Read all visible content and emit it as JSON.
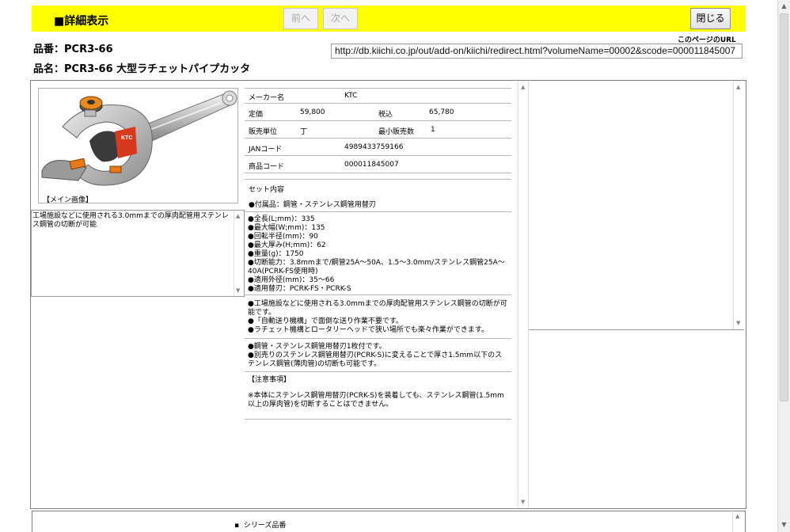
{
  "header": {
    "title": "■詳細表示",
    "prev_label": "前へ",
    "next_label": "次へ",
    "close_label": "閉じる"
  },
  "product": {
    "number_line": "品番：PCR3-66",
    "name_line": "品名：PCR3-66 大型ラチェットパイプカッタ"
  },
  "url": {
    "label": "このページのURL",
    "value": "http://db.kiichi.co.jp/out/add-on/kiichi/redirect.html?volumeName=00002&scode=000011845007"
  },
  "image": {
    "caption": "【メイン画像】",
    "brand": "KTC"
  },
  "description": "工場施設などに使用される3.0mmまでの厚肉配管用ステンレス鋼管の切断が可能",
  "specs": {
    "maker_label": "メーカー名",
    "maker_value": "KTC",
    "price_label": "定価",
    "price_value": "59,800",
    "tax_label": "税込",
    "tax_value": "65,780",
    "unit_label": "販売単位",
    "unit_value": "丁",
    "min_label": "最小販売数",
    "min_value": "1",
    "jan_label": "JANコード",
    "jan_value": "4989433759166",
    "code_label": "商品コード",
    "code_value": "000011845007"
  },
  "set_content": {
    "label": "セット内容",
    "value": "●付属品：鋼管・ステンレス鋼管用替刃"
  },
  "dimensions": [
    "●全長(L;mm)：335",
    "●最大幅(W;mm)：135",
    "●回転半径(mm)：90",
    "●最大厚み(H;mm)：62",
    "●重量(g)：1750",
    "●切断能力：3.8mmまで/鋼管25A～50A、1.5～3.0mm/ステンレス鋼管25A～40A(PCRK-FS使用時)",
    "●適用外径(mm)：35～66",
    "●適用替刃：PCRK-FS・PCRK-S"
  ],
  "features": [
    "●工場施設などに使用される3.0mmまでの厚肉配管用ステンレス鋼管の切断が可能です。",
    "●「自動送り機構」で面倒な送り作業不要です。",
    "●ラチェット機構とロータリーヘッドで狭い場所でも楽々作業ができます。"
  ],
  "notes": [
    "●鋼管・ステンレス鋼管用替刃1枚付です。",
    "●別売りのステンレス鋼管用替刃(PCRK-S)に変えることで厚さ1.5mm以下のステンレス鋼管(薄肉管)の切断も可能です。"
  ],
  "caution": {
    "label": "【注意事項】",
    "text": "※本体にステンレス鋼管用替刃(PCRK-S)を装着しても、ステンレス鋼管(1.5mm以上の厚肉管)を切断することはできません。"
  },
  "series": {
    "label": "シリーズ品番"
  }
}
